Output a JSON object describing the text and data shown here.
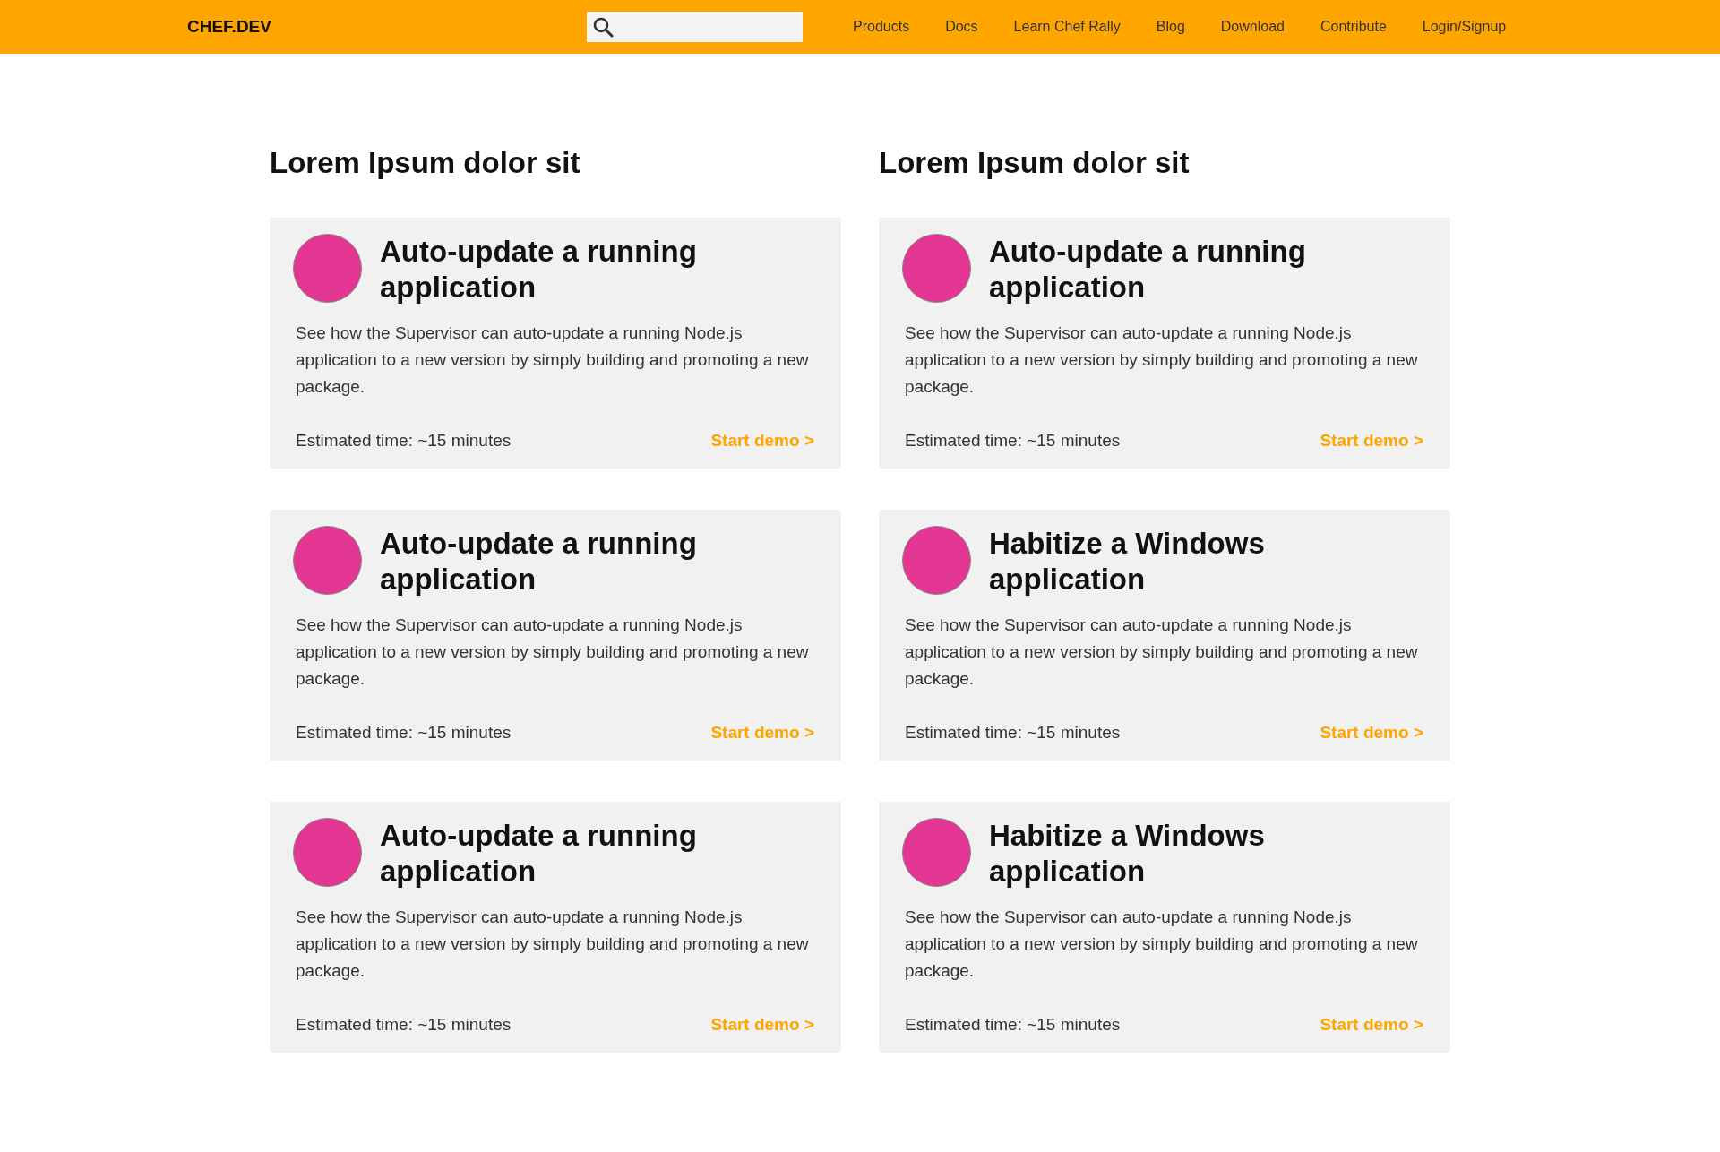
{
  "header": {
    "logo": "CHEF.DEV",
    "nav": [
      "Products",
      "Docs",
      "Learn Chef Rally",
      "Blog",
      "Download",
      "Contribute",
      "Login/Signup"
    ]
  },
  "columns": [
    {
      "heading": "Lorem Ipsum dolor sit",
      "cards": [
        {
          "title": "Auto-update a running application",
          "description": "See how the Supervisor can auto-update a running Node.js application to a new version by simply building and promoting a new package.",
          "time": "Estimated time: ~15 minutes",
          "link": "Start demo >"
        },
        {
          "title": "Auto-update a running application",
          "description": "See how the Supervisor can auto-update a running Node.js application to a new version by simply building and promoting a new package.",
          "time": "Estimated time: ~15 minutes",
          "link": "Start demo >"
        },
        {
          "title": "Auto-update a running application",
          "description": "See how the Supervisor can auto-update a running Node.js application to a new version by simply building and promoting a new package.",
          "time": "Estimated time: ~15 minutes",
          "link": "Start demo >"
        }
      ]
    },
    {
      "heading": "Lorem Ipsum dolor sit",
      "cards": [
        {
          "title": "Auto-update a running application",
          "description": "See how the Supervisor can auto-update a running Node.js application to a new version by simply building and promoting a new package.",
          "time": "Estimated time: ~15 minutes",
          "link": "Start demo >"
        },
        {
          "title": "Habitize a Windows application",
          "description": "See how the Supervisor can auto-update a running Node.js application to a new version by simply building and promoting a new package.",
          "time": "Estimated time: ~15 minutes",
          "link": "Start demo >"
        },
        {
          "title": "Habitize a Windows application",
          "description": "See how the Supervisor can auto-update a running Node.js application to a new version by simply building and promoting a new package.",
          "time": "Estimated time: ~15 minutes",
          "link": "Start demo >"
        }
      ]
    }
  ]
}
